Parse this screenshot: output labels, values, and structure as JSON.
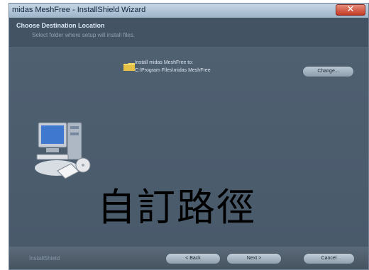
{
  "window": {
    "title": "midas MeshFree - InstallShield Wizard",
    "close_glyph": "✕"
  },
  "header": {
    "heading": "Choose Destination Location",
    "subheading": "Select folder where setup will install files."
  },
  "content": {
    "install_label": "Install midas MeshFree to:",
    "install_path": "C:\\Program Files\\midas MeshFree",
    "change_button": "Change...",
    "overlay_text": "自訂路徑"
  },
  "footer": {
    "brand": "InstallShield",
    "back_button": "< Back",
    "next_button": "Next >",
    "cancel_button": "Cancel"
  },
  "colors": {
    "background": "#4a5a6a",
    "titlebar": "#b3c4d6",
    "close_button": "#c53b25",
    "overlay_text": "#000000"
  },
  "icons": [
    "folder-icon",
    "computer-setup-icon",
    "close-icon"
  ]
}
